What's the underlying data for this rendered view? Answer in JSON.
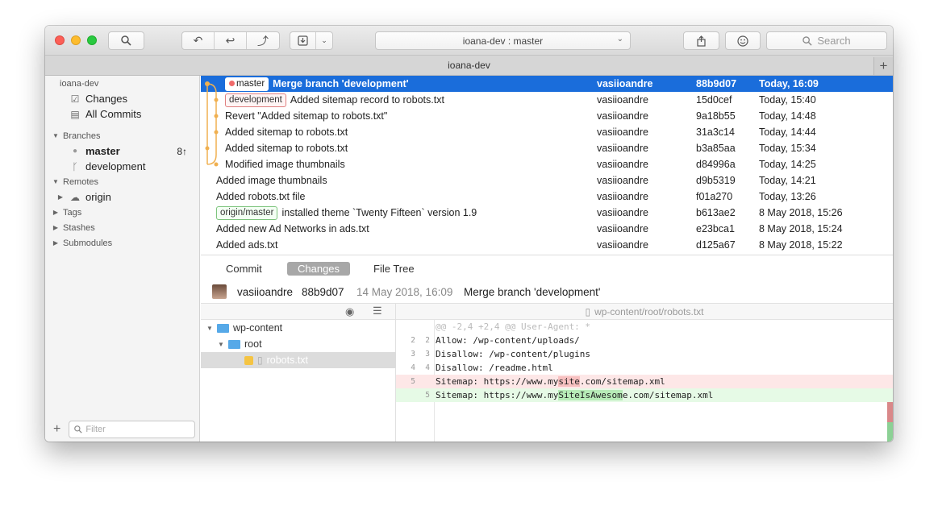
{
  "toolbar": {
    "repo_selector": "ioana-dev : master",
    "search_placeholder": "Search",
    "icons": [
      "search-icon",
      "fetch-icon",
      "pull-icon",
      "push-icon",
      "stash-icon",
      "share-icon",
      "smiley-icon"
    ]
  },
  "tabbar": {
    "title": "ioana-dev",
    "add": "+"
  },
  "sidebar": {
    "repo": "ioana-dev",
    "changes": "Changes",
    "all_commits": "All Commits",
    "branches_header": "Branches",
    "branches": [
      {
        "name": "master",
        "badge": "8↑"
      },
      {
        "name": "development",
        "badge": ""
      }
    ],
    "remotes_header": "Remotes",
    "remotes": [
      "origin"
    ],
    "tags_header": "Tags",
    "stashes_header": "Stashes",
    "submodules_header": "Submodules",
    "filter_placeholder": "Filter",
    "add": "+"
  },
  "commits": [
    {
      "ref": "master",
      "ref_type": "master",
      "message": "Merge branch 'development'",
      "author": "vasiioandre",
      "hash": "88b9d07",
      "date": "Today, 16:09"
    },
    {
      "ref": "development",
      "ref_type": "dev",
      "message": "Added sitemap record to robots.txt",
      "author": "vasiioandre",
      "hash": "15d0cef",
      "date": "Today, 15:40"
    },
    {
      "ref": "",
      "ref_type": "",
      "message": "Revert \"Added sitemap to robots.txt\"",
      "author": "vasiioandre",
      "hash": "9a18b55",
      "date": "Today, 14:48"
    },
    {
      "ref": "",
      "ref_type": "",
      "message": "Added sitemap to robots.txt",
      "author": "vasiioandre",
      "hash": "31a3c14",
      "date": "Today, 14:44"
    },
    {
      "ref": "",
      "ref_type": "",
      "message": "Added sitemap to robots.txt",
      "author": "vasiioandre",
      "hash": "b3a85aa",
      "date": "Today, 15:34"
    },
    {
      "ref": "",
      "ref_type": "",
      "message": "Modified image thumbnails",
      "author": "vasiioandre",
      "hash": "d84996a",
      "date": "Today, 14:25"
    },
    {
      "ref": "",
      "ref_type": "",
      "message": "Added image thumbnails",
      "author": "vasiioandre",
      "hash": "d9b5319",
      "date": "Today, 14:21"
    },
    {
      "ref": "",
      "ref_type": "",
      "message": "Added robots.txt file",
      "author": "vasiioandre",
      "hash": "f01a270",
      "date": "Today, 13:26"
    },
    {
      "ref": "origin/master",
      "ref_type": "origin",
      "message": "installed theme `Twenty Fifteen` version 1.9",
      "author": "vasiioandre",
      "hash": "b613ae2",
      "date": "8 May 2018, 15:26"
    },
    {
      "ref": "",
      "ref_type": "",
      "message": "Added new Ad Networks in ads.txt",
      "author": "vasiioandre",
      "hash": "e23bca1",
      "date": "8 May 2018, 15:24"
    },
    {
      "ref": "",
      "ref_type": "",
      "message": "Added ads.txt",
      "author": "vasiioandre",
      "hash": "d125a67",
      "date": "8 May 2018, 15:22"
    }
  ],
  "detail_tabs": [
    "Commit",
    "Changes",
    "File Tree"
  ],
  "commit_info": {
    "author": "vasiioandre",
    "hash": "88b9d07",
    "date": "14 May 2018, 16:09",
    "message": "Merge branch 'development'"
  },
  "file_tree": [
    {
      "name": "wp-content",
      "type": "folder"
    },
    {
      "name": "root",
      "type": "folder"
    },
    {
      "name": "robots.txt",
      "type": "file"
    }
  ],
  "diff": {
    "file": "wp-content/root/robots.txt",
    "hunk": "@@ -2,4 +2,4 @@ User-Agent: *",
    "lines": [
      {
        "old": "2",
        "new": "2",
        "text": "Allow: /wp-content/uploads/"
      },
      {
        "old": "3",
        "new": "3",
        "text": "Disallow: /wp-content/plugins"
      },
      {
        "old": "4",
        "new": "4",
        "text": "Disallow: /readme.html"
      }
    ],
    "deleted": {
      "old": "5",
      "pre": "Sitemap: https://www.my",
      "hl": "site",
      "post": ".com/sitemap.xml"
    },
    "added": {
      "new": "5",
      "pre": "Sitemap: https://www.my",
      "hl": "SiteIsAwesom",
      "post": "e.com/sitemap.xml"
    }
  },
  "colors": {
    "selection": "#1a6ddb",
    "graph": "#f0b050",
    "deleted": "#fde7e7",
    "added": "#e6fae6"
  }
}
